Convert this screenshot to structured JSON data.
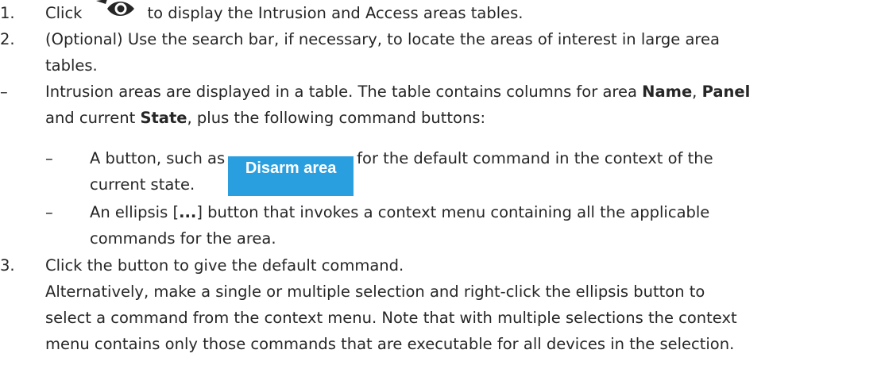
{
  "steps": [
    {
      "marker": "1.",
      "before": "Click",
      "after": "to display the Intrusion and Access areas tables.",
      "icon": "eye-icon"
    },
    {
      "marker": "2.",
      "line1": "(Optional) Use the search bar, if necessary, to locate the areas of interest in large area",
      "line2": "tables."
    },
    {
      "marker": "3.",
      "line1": "Click the button to give the default command.",
      "line2": "Alternatively, make a single or multiple selection and right-click the ellipsis button to",
      "line3": "select a command from the context menu. Note that with multiple selections the context",
      "line4": "menu contains only those commands that are executable for all devices in the selection."
    }
  ],
  "bullet": {
    "marker": "–",
    "text_a": "Intrusion areas are displayed in a table. The table contains columns for area",
    "bold_name": "Name",
    "sep": ",",
    "bold_panel": "Panel",
    "text_b": "and current",
    "bold_state": "State",
    "text_c": ", plus the following command buttons:"
  },
  "sub_bullets": [
    {
      "marker": "–",
      "before": "A button, such as",
      "button_label": "Disarm area",
      "after": "for the default command in the context of the",
      "line2": "current state."
    },
    {
      "marker": "–",
      "before": "An ellipsis [",
      "bold": "...",
      "after": "] button that invokes a context menu containing all the applicable",
      "line2": "commands for the area."
    }
  ],
  "colors": {
    "text": "#262626",
    "button_bg": "#2a9fe0",
    "button_text": "#ffffff"
  }
}
